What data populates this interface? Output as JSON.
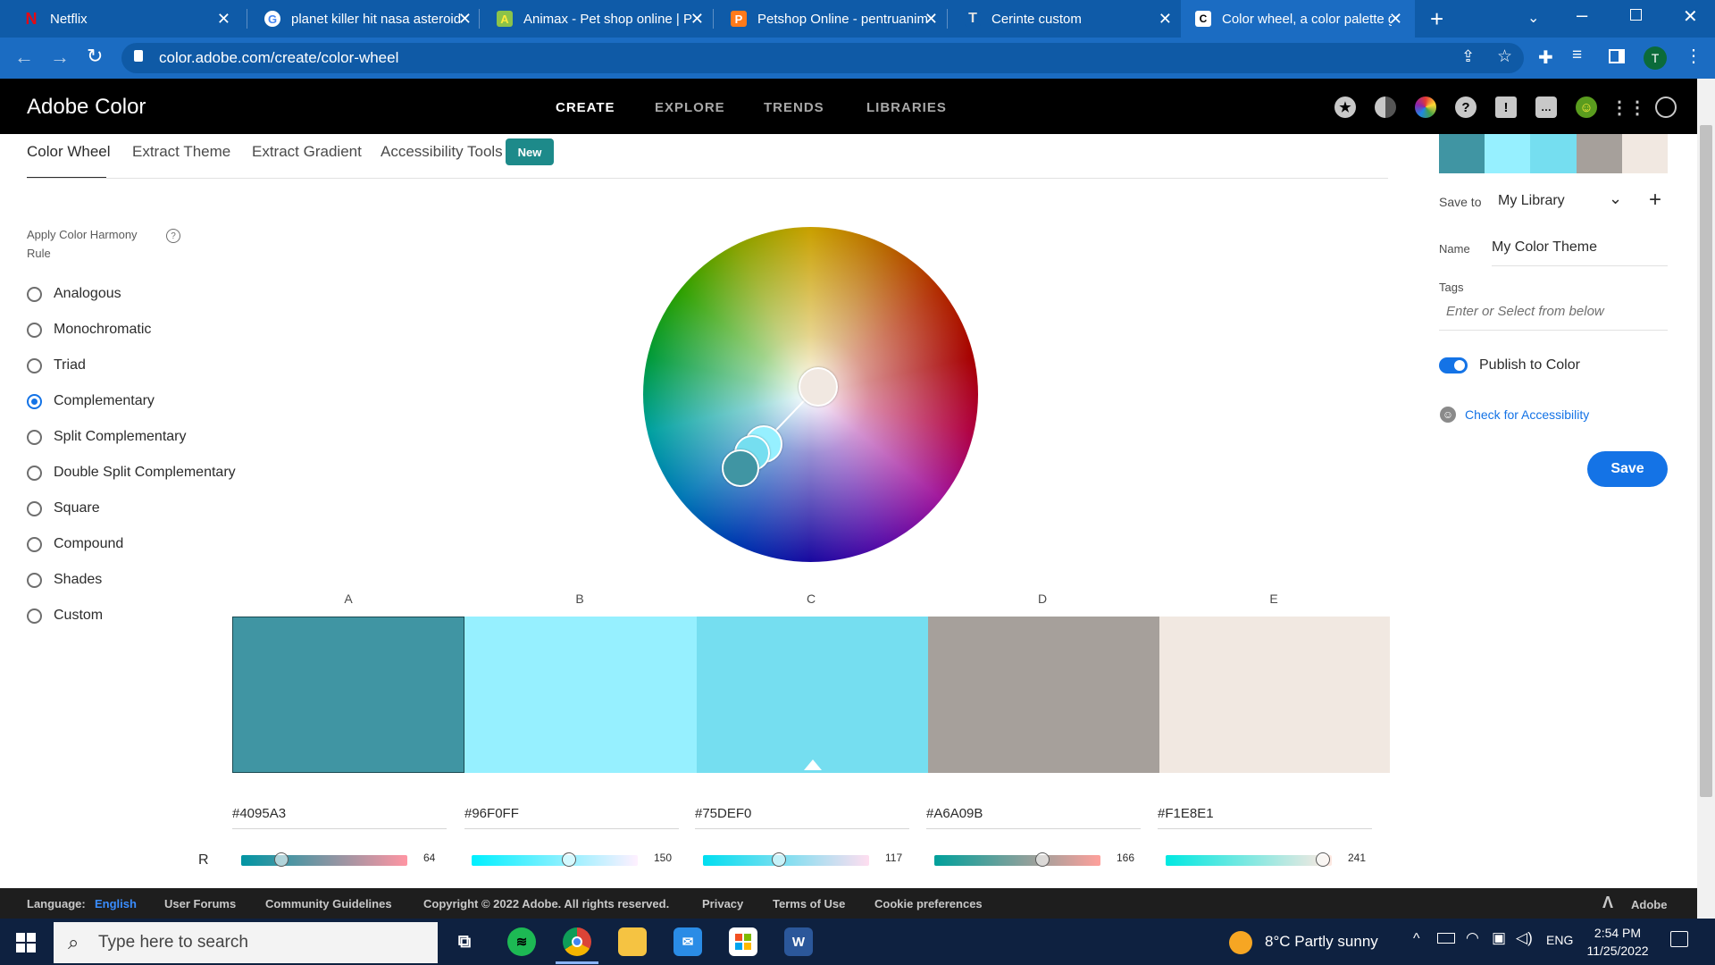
{
  "browser": {
    "tabs": [
      {
        "label": "Netflix",
        "favicon": "N",
        "fav_bg": "#000000",
        "fav_fg": "#e50914"
      },
      {
        "label": "planet killer hit nasa asteroid",
        "favicon": "G",
        "fav_bg": "#ffffff",
        "fav_fg": "#4285f4"
      },
      {
        "label": "Animax - Pet shop online | Pr",
        "favicon": "A",
        "fav_bg": "#8bc34a",
        "fav_fg": "#ffeb3b"
      },
      {
        "label": "Petshop Online - pentruanimal",
        "favicon": "P",
        "fav_bg": "#ff7a1a",
        "fav_fg": "#ffffff"
      },
      {
        "label": "Cerinte custom",
        "favicon": "T",
        "fav_bg": "#e0e0e0",
        "fav_fg": "#333333"
      },
      {
        "label": "Color wheel, a color palette g",
        "favicon": "C",
        "fav_bg": "#ffffff",
        "fav_fg": "#000000"
      }
    ],
    "url": "color.adobe.com/create/color-wheel",
    "profile_initial": "T"
  },
  "header": {
    "brand": "Adobe Color",
    "nav": [
      "CREATE",
      "EXPLORE",
      "TRENDS",
      "LIBRARIES"
    ]
  },
  "subtabs": {
    "items": [
      "Color Wheel",
      "Extract Theme",
      "Extract Gradient",
      "Accessibility Tools"
    ],
    "badge": "New"
  },
  "harmony": {
    "title_line1": "Apply Color Harmony",
    "title_line2": "Rule",
    "help": "?",
    "rules": [
      "Analogous",
      "Monochromatic",
      "Triad",
      "Complementary",
      "Split Complementary",
      "Double Split Complementary",
      "Square",
      "Compound",
      "Shades",
      "Custom"
    ],
    "selected": "Complementary"
  },
  "swatches": [
    {
      "letter": "A",
      "hex": "#4095A3",
      "r": 64
    },
    {
      "letter": "B",
      "hex": "#96F0FF",
      "r": 150
    },
    {
      "letter": "C",
      "hex": "#75DEF0",
      "r": 117
    },
    {
      "letter": "D",
      "hex": "#A6A09B",
      "r": 166
    },
    {
      "letter": "E",
      "hex": "#F1E8E1",
      "r": 241
    }
  ],
  "channel_label": "R",
  "right_panel": {
    "save_to_label": "Save to",
    "library": "My Library",
    "name_label": "Name",
    "name_value": "My Color Theme",
    "tags_label": "Tags",
    "tags_placeholder": "Enter or Select from below",
    "publish_label": "Publish to Color",
    "accessibility_link": "Check for Accessibility",
    "save_button": "Save"
  },
  "footer": {
    "language_label": "Language:",
    "language_value": "English",
    "links": [
      "User Forums",
      "Community Guidelines",
      "Copyright © 2022 Adobe. All rights reserved.",
      "Privacy",
      "Terms of Use",
      "Cookie preferences"
    ],
    "adobe": "Adobe"
  },
  "taskbar": {
    "search_placeholder": "Type here to search",
    "weather": "8°C  Partly sunny",
    "lang": "ENG",
    "time": "2:54 PM",
    "date": "11/25/2022"
  }
}
